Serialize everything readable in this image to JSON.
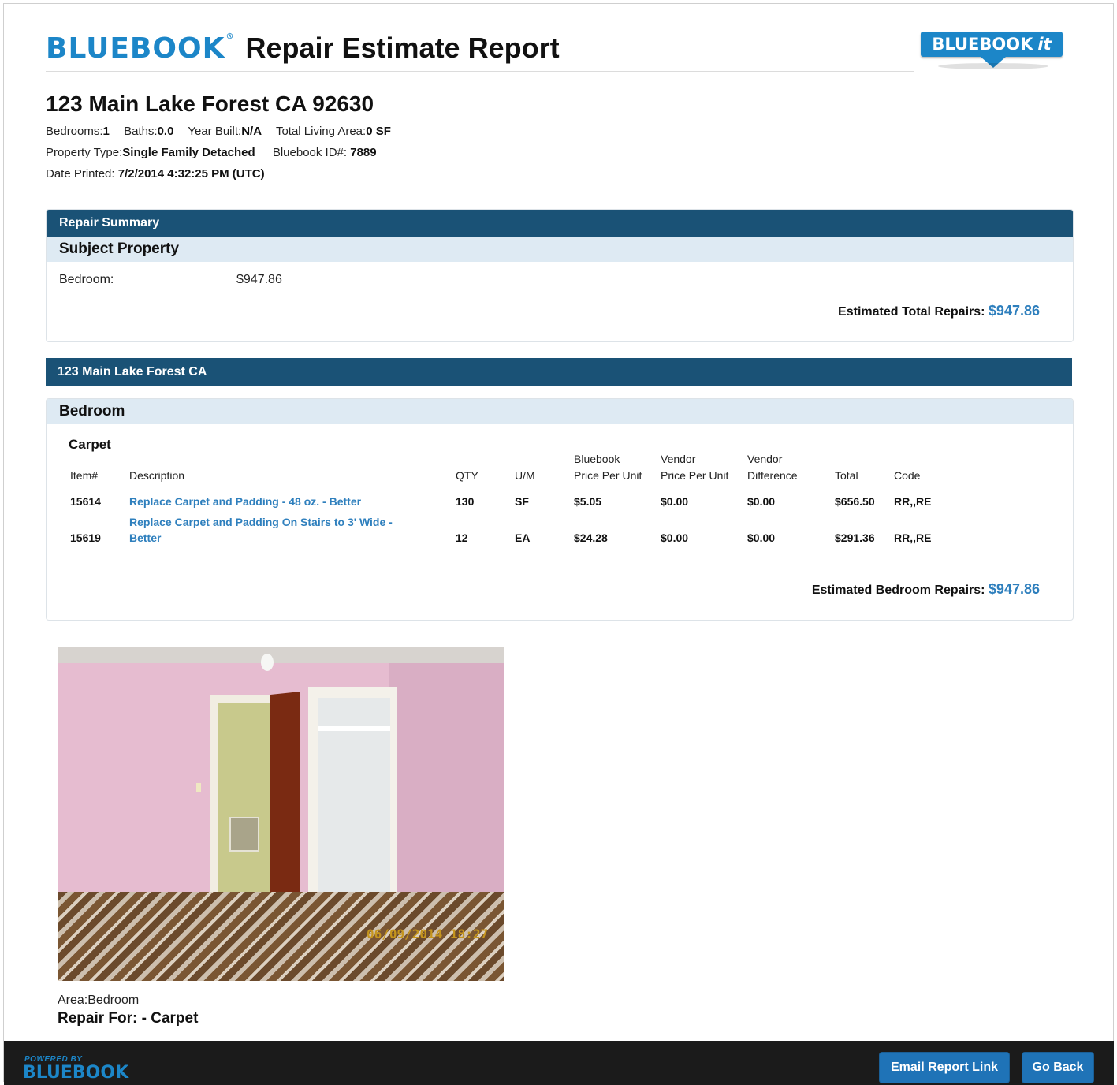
{
  "header": {
    "brand": "BLUEBOOK",
    "title": "Repair Estimate Report",
    "badge_brand": "BLUEBOOK",
    "badge_suffix": "it"
  },
  "property": {
    "address": "123 Main Lake Forest CA 92630",
    "bedrooms_label": "Bedrooms:",
    "bedrooms": "1",
    "baths_label": "Baths:",
    "baths": "0.0",
    "year_built_label": "Year Built:",
    "year_built": "N/A",
    "living_area_label": "Total Living Area:",
    "living_area": "0 SF",
    "type_label": "Property Type:",
    "type": "Single Family Detached",
    "id_label": "Bluebook ID#:",
    "id": "7889",
    "printed_label": "Date Printed:",
    "printed": "7/2/2014 4:32:25 PM (UTC)"
  },
  "summary": {
    "header": "Repair Summary",
    "subheader": "Subject Property",
    "row_label": "Bedroom:",
    "row_value": "$947.86",
    "total_label": "Estimated Total Repairs:",
    "total_value": "$947.86"
  },
  "section": {
    "header": "123 Main Lake Forest CA",
    "subheader": "Bedroom",
    "category": "Carpet",
    "columns": {
      "item": "Item#",
      "description": "Description",
      "qty": "QTY",
      "um": "U/M",
      "bluebook_top": "Bluebook",
      "bluebook_bottom": "Price Per Unit",
      "vendor_top": "Vendor",
      "vendor_bottom": "Price Per Unit",
      "diff_top": "Vendor",
      "diff_bottom": "Difference",
      "total": "Total",
      "code": "Code"
    },
    "rows": [
      {
        "item": "15614",
        "description": "Replace Carpet and Padding - 48 oz. - Better",
        "qty": "130",
        "um": "SF",
        "bluebook_price": "$5.05",
        "vendor_price": "$0.00",
        "difference": "$0.00",
        "total": "$656.50",
        "code": "RR,,RE"
      },
      {
        "item": "15619",
        "description_line1": "Replace Carpet and Padding On Stairs to 3' Wide -",
        "description_line2": "Better",
        "qty": "12",
        "um": "EA",
        "bluebook_price": "$24.28",
        "vendor_price": "$0.00",
        "difference": "$0.00",
        "total": "$291.36",
        "code": "RR,,RE"
      }
    ],
    "total_label": "Estimated Bedroom Repairs:",
    "total_value": "$947.86"
  },
  "photo": {
    "timestamp": "06/09/2014 18:27",
    "area_label": "Area:Bedroom",
    "repair_label": "Repair For: - Carpet"
  },
  "footer": {
    "powered_by": "POWERED BY",
    "brand": "BLUEBOOK",
    "email_button": "Email Report Link",
    "back_button": "Go Back"
  },
  "colors": {
    "brand_blue": "#1c86c8",
    "header_navy": "#1a5276",
    "link_blue": "#2e7fbd",
    "subheader_bg": "#deeaf3"
  }
}
